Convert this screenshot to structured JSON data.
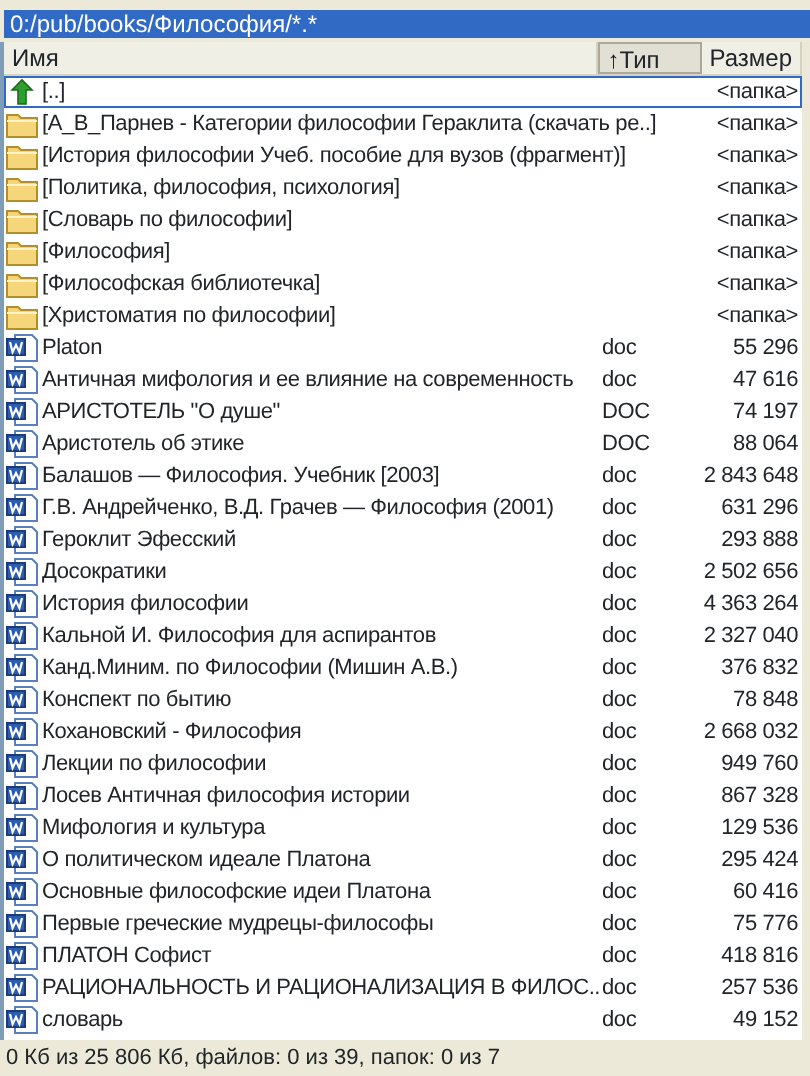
{
  "path_bar": {
    "text": "0:/pub/books/Философия/*.*",
    "active": true
  },
  "columns": [
    {
      "label": "Имя",
      "sorted": false
    },
    {
      "label": "↑Тип",
      "sorted": true
    },
    {
      "label": "Размер",
      "sorted": false
    }
  ],
  "rows": [
    {
      "kind": "up",
      "name": "[..]",
      "size": "<папка>",
      "focused": true
    },
    {
      "kind": "folder",
      "name": "[А_В_Парнев - Категории философии Гераклита (скачать ре..]",
      "size": "<папка>",
      "focused": false
    },
    {
      "kind": "folder",
      "name": "[История философии Учеб. пособие для вузов (фрагмент)]",
      "size": "<папка>",
      "focused": false
    },
    {
      "kind": "folder",
      "name": "[Политика, философия, психология]",
      "size": "<папка>",
      "focused": false
    },
    {
      "kind": "folder",
      "name": "[Словарь по философии]",
      "size": "<папка>",
      "focused": false
    },
    {
      "kind": "folder",
      "name": "[Философия]",
      "size": "<папка>",
      "focused": false
    },
    {
      "kind": "folder",
      "name": "[Философская библиотечка]",
      "size": "<папка>",
      "focused": false
    },
    {
      "kind": "folder",
      "name": "[Христоматия по философии]",
      "size": "<папка>",
      "focused": false
    },
    {
      "kind": "doc",
      "name": "Platon",
      "type": "doc",
      "size": "55 296",
      "focused": false
    },
    {
      "kind": "doc",
      "name": "Античная мифология и ее влияние на современность",
      "type": "doc",
      "size": "47 616",
      "focused": false
    },
    {
      "kind": "doc",
      "name": "АРИСТОТЕЛЬ \"О душе\"",
      "type": "DOC",
      "size": "74 197",
      "focused": false
    },
    {
      "kind": "doc",
      "name": "Аристотель об этике",
      "type": "DOC",
      "size": "88 064",
      "focused": false
    },
    {
      "kind": "doc",
      "name": "Балашов — Философия. Учебник [2003]",
      "type": "doc",
      "size": "2 843 648",
      "focused": false
    },
    {
      "kind": "doc",
      "name": "Г.В. Андрейченко, В.Д. Грачев — Философия (2001)",
      "type": "doc",
      "size": "631 296",
      "focused": false
    },
    {
      "kind": "doc",
      "name": "Героклит Эфесский",
      "type": "doc",
      "size": "293 888",
      "focused": false
    },
    {
      "kind": "doc",
      "name": "Досократики",
      "type": "doc",
      "size": "2 502 656",
      "focused": false
    },
    {
      "kind": "doc",
      "name": "История философии",
      "type": "doc",
      "size": "4 363 264",
      "focused": false
    },
    {
      "kind": "doc",
      "name": "Кальной И. Философия для аспирантов",
      "type": "doc",
      "size": "2 327 040",
      "focused": false
    },
    {
      "kind": "doc",
      "name": "Канд.Миним. по Философии (Мишин А.В.)",
      "type": "doc",
      "size": "376 832",
      "focused": false
    },
    {
      "kind": "doc",
      "name": "Конспект по бытию",
      "type": "doc",
      "size": "78 848",
      "focused": false
    },
    {
      "kind": "doc",
      "name": "Кохановский - Философия",
      "type": "doc",
      "size": "2 668 032",
      "focused": false
    },
    {
      "kind": "doc",
      "name": "Лекции по философии",
      "type": "doc",
      "size": "949 760",
      "focused": false
    },
    {
      "kind": "doc",
      "name": "Лосев Античная философия истории",
      "type": "doc",
      "size": "867 328",
      "focused": false
    },
    {
      "kind": "doc",
      "name": "Мифология и культура",
      "type": "doc",
      "size": "129 536",
      "focused": false
    },
    {
      "kind": "doc",
      "name": "О политическом идеале Платона",
      "type": "doc",
      "size": "295 424",
      "focused": false
    },
    {
      "kind": "doc",
      "name": "Основные философские идеи Платона",
      "type": "doc",
      "size": "60 416",
      "focused": false
    },
    {
      "kind": "doc",
      "name": "Первые греческие мудрецы-философы",
      "type": "doc",
      "size": "75 776",
      "focused": false
    },
    {
      "kind": "doc",
      "name": "ПЛАТОН Софист",
      "type": "doc",
      "size": "418 816",
      "focused": false
    },
    {
      "kind": "doc",
      "name": "РАЦИОНАЛЬНОСТЬ И РАЦИОНАЛИЗАЦИЯ В ФИЛОС..",
      "type": "doc",
      "size": "257 536",
      "focused": false
    },
    {
      "kind": "doc",
      "name": "словарь",
      "type": "doc",
      "size": "49 152",
      "focused": false
    }
  ],
  "status_bar": "0 Кб из 25 806 Кб, файлов: 0 из 39, папок: 0 из 7"
}
